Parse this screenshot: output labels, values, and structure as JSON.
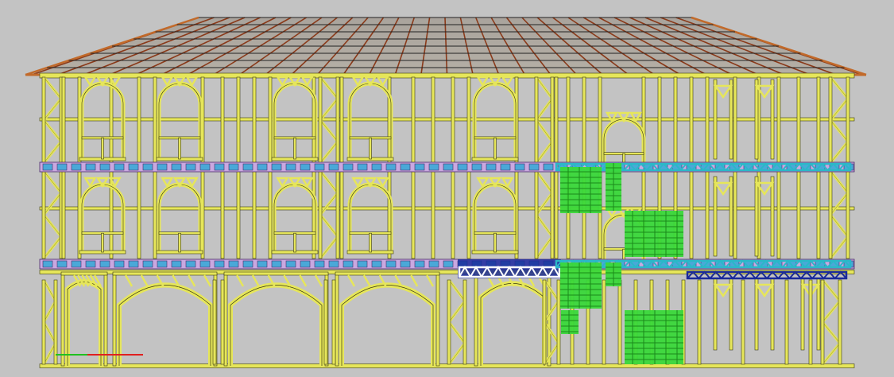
{
  "colors": {
    "background": "#c3c3c3",
    "frame": "#e6e65a",
    "frame_edge": "#3a3a10",
    "roof_rafter": "#8a3a1a",
    "roof_purlin": "#222222",
    "roof_edge": "#c26a2a",
    "floor_band": "#c9a8e0",
    "floor_band_edge": "#4a2a6a",
    "floor_block": "#4aa8d8",
    "truss_blue": "#1a2a9a",
    "truss_cyan": "#2ab8c8",
    "panel_green": "#3ad83a",
    "axis_x": "#e02020",
    "axis_y": "#20c020"
  },
  "axis_indicator": {
    "x_axis_icon": "axis-x-icon",
    "y_axis_icon": "axis-y-icon"
  }
}
